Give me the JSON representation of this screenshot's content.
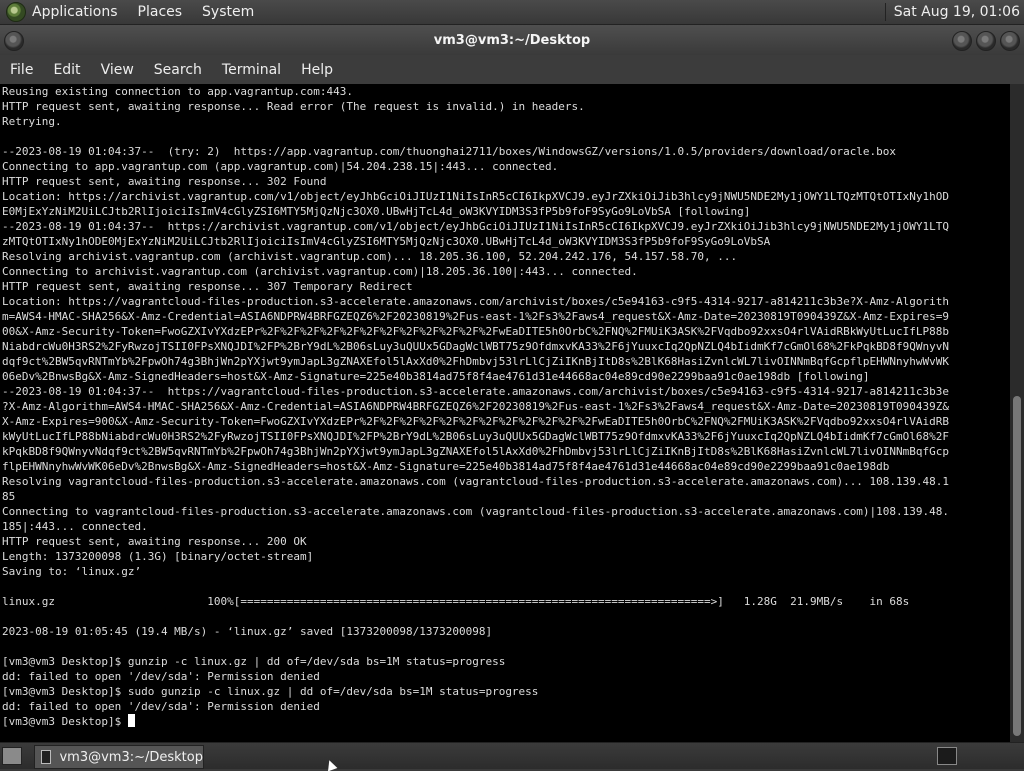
{
  "top_panel": {
    "menu": [
      "Applications",
      "Places",
      "System"
    ],
    "clock": "Sat Aug 19, 01:06"
  },
  "window": {
    "title": "vm3@vm3:~/Desktop",
    "menu": [
      "File",
      "Edit",
      "View",
      "Search",
      "Terminal",
      "Help"
    ]
  },
  "terminal": {
    "lines": [
      "Reusing existing connection to app.vagrantup.com:443.",
      "HTTP request sent, awaiting response... Read error (The request is invalid.) in headers.",
      "Retrying.",
      "",
      "--2023-08-19 01:04:37--  (try: 2)  https://app.vagrantup.com/thuonghai2711/boxes/WindowsGZ/versions/1.0.5/providers/download/oracle.box",
      "Connecting to app.vagrantup.com (app.vagrantup.com)|54.204.238.15|:443... connected.",
      "HTTP request sent, awaiting response... 302 Found",
      "Location: https://archivist.vagrantup.com/v1/object/eyJhbGciOiJIUzI1NiIsInR5cCI6IkpXVCJ9.eyJrZXkiOiJib3hlcy9jNWU5NDE2My1jOWY1LTQzMTQtOTIxNy1hODE0MjExYzNiM2UiLCJtb2RlIjoiciIsImV4cGlyZSI6MTY5MjQzNjc3OX0.UBwHjTcL4d_oW3KVYIDM3S3fP5b9foF9SyGo9LoVbSA [following]",
      "--2023-08-19 01:04:37--  https://archivist.vagrantup.com/v1/object/eyJhbGciOiJIUzI1NiIsInR5cCI6IkpXVCJ9.eyJrZXkiOiJib3hlcy9jNWU5NDE2My1jOWY1LTQzMTQtOTIxNy1hODE0MjExYzNiM2UiLCJtb2RlIjoiciIsImV4cGlyZSI6MTY5MjQzNjc3OX0.UBwHjTcL4d_oW3KVYIDM3S3fP5b9foF9SyGo9LoVbSA",
      "Resolving archivist.vagrantup.com (archivist.vagrantup.com)... 18.205.36.100, 52.204.242.176, 54.157.58.70, ...",
      "Connecting to archivist.vagrantup.com (archivist.vagrantup.com)|18.205.36.100|:443... connected.",
      "HTTP request sent, awaiting response... 307 Temporary Redirect",
      "Location: https://vagrantcloud-files-production.s3-accelerate.amazonaws.com/archivist/boxes/c5e94163-c9f5-4314-9217-a814211c3b3e?X-Amz-Algorithm=AWS4-HMAC-SHA256&X-Amz-Credential=ASIA6NDPRW4BRFGZEQZ6%2F20230819%2Fus-east-1%2Fs3%2Faws4_request&X-Amz-Date=20230819T090439Z&X-Amz-Expires=900&X-Amz-Security-Token=FwoGZXIvYXdzEPr%2F%2F%2F%2F%2F%2F%2F%2F%2F%2F%2F%2FwEaDITE5h0OrbC%2FNQ%2FMUiK3ASK%2FVqdbo92xxsO4rlVAidRBkWyUtLucIfLP88bNiabdrcWu0H3RS2%2FyRwzojTSII0FPsXNQJDI%2FP%2BrY9dL%2B06sLuy3uQUUx5GDagWclWBT75z9OfdmxvKA33%2F6jYuuxcIq2QpNZLQ4bIidmKf7cGmOl68%2FkPqkBD8f9QWnyvNdqf9ct%2BW5qvRNTmYb%2FpwOh74g3BhjWn2pYXjwt9ymJapL3gZNAXEfol5lAxXd0%2FhDmbvj53lrLlCjZiIKnBjItD8s%2BlK68HasiZvnlcWL7livOINNmBqfGcpflpEHWNnyhwWvWK06eDv%2BnwsBg&X-Amz-SignedHeaders=host&X-Amz-Signature=225e40b3814ad75f8f4ae4761d31e44668ac04e89cd90e2299baa91c0ae198db [following]",
      "--2023-08-19 01:04:37--  https://vagrantcloud-files-production.s3-accelerate.amazonaws.com/archivist/boxes/c5e94163-c9f5-4314-9217-a814211c3b3e?X-Amz-Algorithm=AWS4-HMAC-SHA256&X-Amz-Credential=ASIA6NDPRW4BRFGZEQZ6%2F20230819%2Fus-east-1%2Fs3%2Faws4_request&X-Amz-Date=20230819T090439Z&X-Amz-Expires=900&X-Amz-Security-Token=FwoGZXIvYXdzEPr%2F%2F%2F%2F%2F%2F%2F%2F%2F%2F%2F%2FwEaDITE5h0OrbC%2FNQ%2FMUiK3ASK%2FVqdbo92xxsO4rlVAidRBkWyUtLucIfLP88bNiabdrcWu0H3RS2%2FyRwzojTSII0FPsXNQJDI%2FP%2BrY9dL%2B06sLuy3uQUUx5GDagWclWBT75z9OfdmxvKA33%2F6jYuuxcIq2QpNZLQ4bIidmKf7cGmOl68%2FkPqkBD8f9QWnyvNdqf9ct%2BW5qvRNTmYb%2FpwOh74g3BhjWn2pYXjwt9ymJapL3gZNAXEfol5lAxXd0%2FhDmbvj53lrLlCjZiIKnBjItD8s%2BlK68HasiZvnlcWL7livOINNmBqfGcpflpEHWNnyhwWvWK06eDv%2BnwsBg&X-Amz-SignedHeaders=host&X-Amz-Signature=225e40b3814ad75f8f4ae4761d31e44668ac04e89cd90e2299baa91c0ae198db",
      "Resolving vagrantcloud-files-production.s3-accelerate.amazonaws.com (vagrantcloud-files-production.s3-accelerate.amazonaws.com)... 108.139.48.185",
      "Connecting to vagrantcloud-files-production.s3-accelerate.amazonaws.com (vagrantcloud-files-production.s3-accelerate.amazonaws.com)|108.139.48.185|:443... connected.",
      "HTTP request sent, awaiting response... 200 OK",
      "Length: 1373200098 (1.3G) [binary/octet-stream]",
      "Saving to: ‘linux.gz’",
      "",
      "linux.gz                       100%[=======================================================================>]   1.28G  21.9MB/s    in 68s",
      "",
      "2023-08-19 01:05:45 (19.4 MB/s) - ‘linux.gz’ saved [1373200098/1373200098]",
      "",
      "[vm3@vm3 Desktop]$ gunzip -c linux.gz | dd of=/dev/sda bs=1M status=progress",
      "dd: failed to open '/dev/sda': Permission denied",
      "[vm3@vm3 Desktop]$ sudo gunzip -c linux.gz | dd of=/dev/sda bs=1M status=progress",
      "dd: failed to open '/dev/sda': Permission denied",
      "[vm3@vm3 Desktop]$ "
    ]
  },
  "taskbar": {
    "task_label": "vm3@vm3:~/Desktop"
  }
}
